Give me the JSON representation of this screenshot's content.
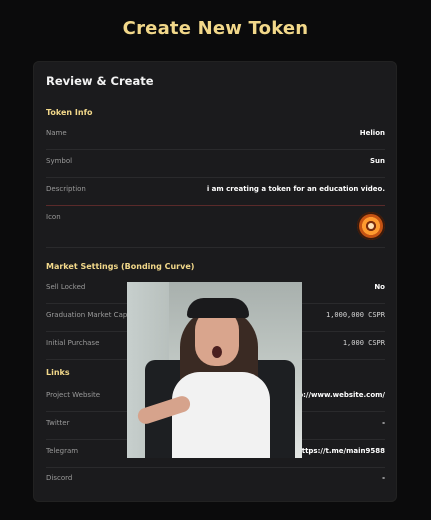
{
  "page": {
    "title": "Create New Token"
  },
  "card": {
    "title": "Review & Create",
    "sections": {
      "token_info": "Token Info",
      "market_settings": "Market Settings (Bonding Curve)",
      "links": "Links"
    },
    "token_info": {
      "name_label": "Name",
      "name_value": "Helion",
      "symbol_label": "Symbol",
      "symbol_value": "Sun",
      "description_label": "Description",
      "description_value": "i am creating a token for an education video.",
      "icon_label": "Icon"
    },
    "market": {
      "sell_locked_label": "Sell Locked",
      "sell_locked_value": "No",
      "graduation_label": "Graduation Market Cap",
      "graduation_value": "1,000,000 CSPR",
      "initial_purchase_label": "Initial Purchase",
      "initial_purchase_value": "1,000 CSPR"
    },
    "links": {
      "website_label": "Project Website",
      "website_value": "http://www.website.com/",
      "twitter_label": "Twitter",
      "twitter_value": "-",
      "telegram_label": "Telegram",
      "telegram_value": "https://t.me/main9588",
      "discord_label": "Discord",
      "discord_value": "-"
    }
  },
  "colors": {
    "accent": "#f2d88a",
    "background": "#0b0b0c",
    "card": "#1b1b1d"
  },
  "icons": {
    "token_icon": "sun-token-icon"
  }
}
